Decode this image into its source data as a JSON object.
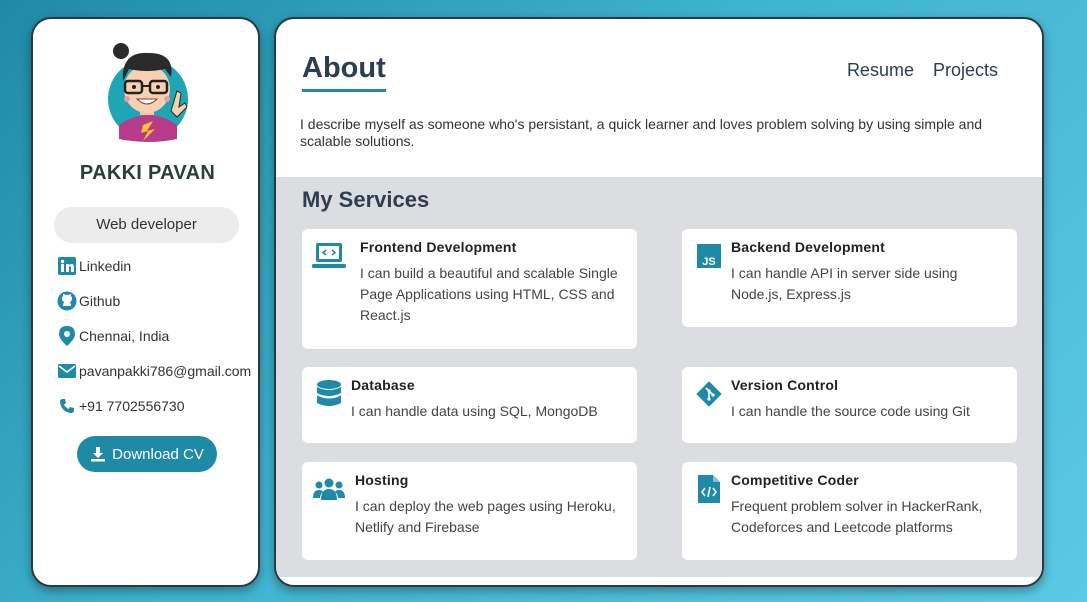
{
  "profile": {
    "name": "PAKKI PAVAN",
    "role": "Web developer",
    "contacts": {
      "linkedin": "Linkedin",
      "github": "Github",
      "location": "Chennai, India",
      "email": "pavanpakki786@gmail.com",
      "phone": "+91 7702556730"
    },
    "download_label": "Download CV"
  },
  "header": {
    "title": "About",
    "nav": [
      "Resume",
      "Projects"
    ]
  },
  "about_text": "I describe myself as someone who's persistant, a quick learner and loves problem solving by using simple and scalable solutions.",
  "services": {
    "title": "My Services",
    "items": [
      {
        "title": "Frontend Development",
        "text": "I can build a beautiful and scalable Single Page Applications using HTML, CSS and React.js",
        "icon": "laptop-code-icon"
      },
      {
        "title": "Backend Development",
        "text": "I can handle API in server side using Node.js, Express.js",
        "icon": "js-icon"
      },
      {
        "title": "Database",
        "text": "I can handle data using SQL, MongoDB",
        "icon": "database-icon"
      },
      {
        "title": "Version Control",
        "text": "I can handle the source code using Git",
        "icon": "git-icon"
      },
      {
        "title": "Hosting",
        "text": "I can deploy the web pages using Heroku, Netlify and Firebase",
        "icon": "users-icon"
      },
      {
        "title": "Competitive Coder",
        "text": "Frequent problem solver in HackerRank, Codeforces and Leetcode platforms",
        "icon": "file-code-icon"
      }
    ]
  },
  "colors": {
    "accent": "#1f8aa6",
    "panel": "#dcdde0",
    "heading": "#2c3e50"
  }
}
